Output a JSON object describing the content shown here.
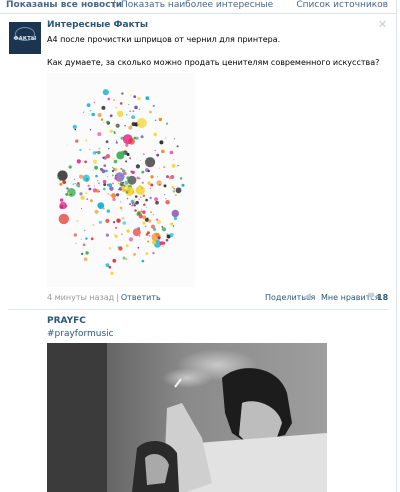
{
  "topbar": {
    "all_news": "Показаны все новости",
    "separator": "|",
    "show_interesting": "Показать наиболее интересные",
    "sources_list": "Список источников"
  },
  "post1": {
    "close_icon": "close-icon",
    "avatar_text": "ФАКТЫ",
    "author": "Интересные Факты",
    "text_line1": "А4 после прочистки шприцов от чернил для принтера.",
    "text_line2": "Как думаете, за сколько можно продать ценителям современного искусства?",
    "time": "4 минуты назад",
    "dot": "|",
    "reply": "Ответить",
    "share": "Поделиться",
    "share_icon": "megaphone-icon",
    "like": "Мне нравится",
    "like_icon": "heart-icon",
    "like_count": "18"
  },
  "post2": {
    "author": "PRAYFC",
    "hashtag": "#prayformusic"
  },
  "colors": {
    "link": "#2b587a",
    "accent": "#45688e",
    "border": "#dae1e8"
  }
}
